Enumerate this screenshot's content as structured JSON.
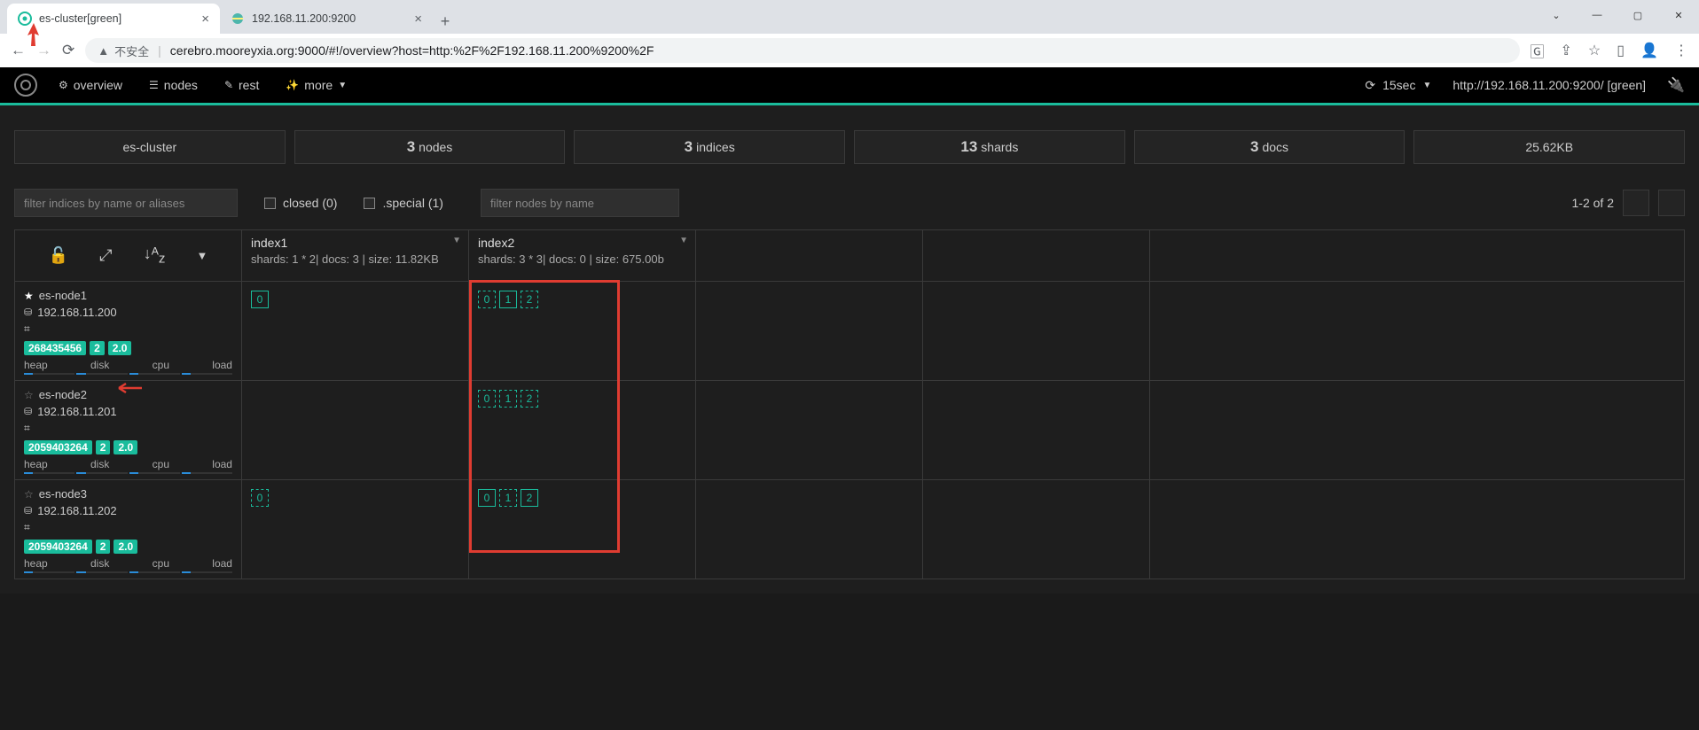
{
  "browser": {
    "tabs": [
      {
        "title": "es-cluster[green]"
      },
      {
        "title": "192.168.11.200:9200"
      }
    ],
    "security_label": "不安全",
    "url": "cerebro.mooreyxia.org:9000/#!/overview?host=http:%2F%2F192.168.11.200%9200%2F",
    "url_display": "cerebro.mooreyxia.org:9000/#!/overview?host=http:%2F%2F192.168.11.200%9200%2F"
  },
  "nav": {
    "overview": "overview",
    "nodes": "nodes",
    "rest": "rest",
    "more": "more",
    "refresh": "15sec",
    "host": "http://192.168.11.200:9200/ [green]"
  },
  "stats": {
    "cluster": "es-cluster",
    "nodes_n": "3",
    "nodes_l": "nodes",
    "indices_n": "3",
    "indices_l": "indices",
    "shards_n": "13",
    "shards_l": "shards",
    "docs_n": "3",
    "docs_l": "docs",
    "size": "25.62KB"
  },
  "filters": {
    "idx_ph": "filter indices by name or aliases",
    "closed": "closed (0)",
    "special": ".special (1)",
    "node_ph": "filter nodes by name",
    "pager": "1-2 of 2"
  },
  "indices": [
    {
      "name": "index1",
      "meta": "shards: 1 * 2| docs: 3 | size: 11.82KB"
    },
    {
      "name": "index2",
      "meta": "shards: 3 * 3| docs: 0 | size: 675.00b"
    }
  ],
  "nodes": [
    {
      "name": "es-node1",
      "ip": "192.168.11.200",
      "primary": true,
      "b1": "268435456",
      "b2": "2",
      "b3": "2.0"
    },
    {
      "name": "es-node2",
      "ip": "192.168.11.201",
      "primary": false,
      "b1": "2059403264",
      "b2": "2",
      "b3": "2.0"
    },
    {
      "name": "es-node3",
      "ip": "192.168.11.202",
      "primary": false,
      "b1": "2059403264",
      "b2": "2",
      "b3": "2.0"
    }
  ],
  "metrics": {
    "heap": "heap",
    "disk": "disk",
    "cpu": "cpu",
    "load": "load"
  },
  "grid_shards": {
    "r0": {
      "i1": [
        {
          "n": "0",
          "s": "solid"
        }
      ],
      "i2": [
        {
          "n": "0",
          "s": "dashed"
        },
        {
          "n": "1",
          "s": "solid"
        },
        {
          "n": "2",
          "s": "dashed"
        }
      ]
    },
    "r1": {
      "i1": [],
      "i2": [
        {
          "n": "0",
          "s": "dashed"
        },
        {
          "n": "1",
          "s": "dashed"
        },
        {
          "n": "2",
          "s": "dashed"
        }
      ]
    },
    "r2": {
      "i1": [
        {
          "n": "0",
          "s": "dashed"
        }
      ],
      "i2": [
        {
          "n": "0",
          "s": "solid"
        },
        {
          "n": "1",
          "s": "dashed"
        },
        {
          "n": "2",
          "s": "solid"
        }
      ]
    }
  }
}
